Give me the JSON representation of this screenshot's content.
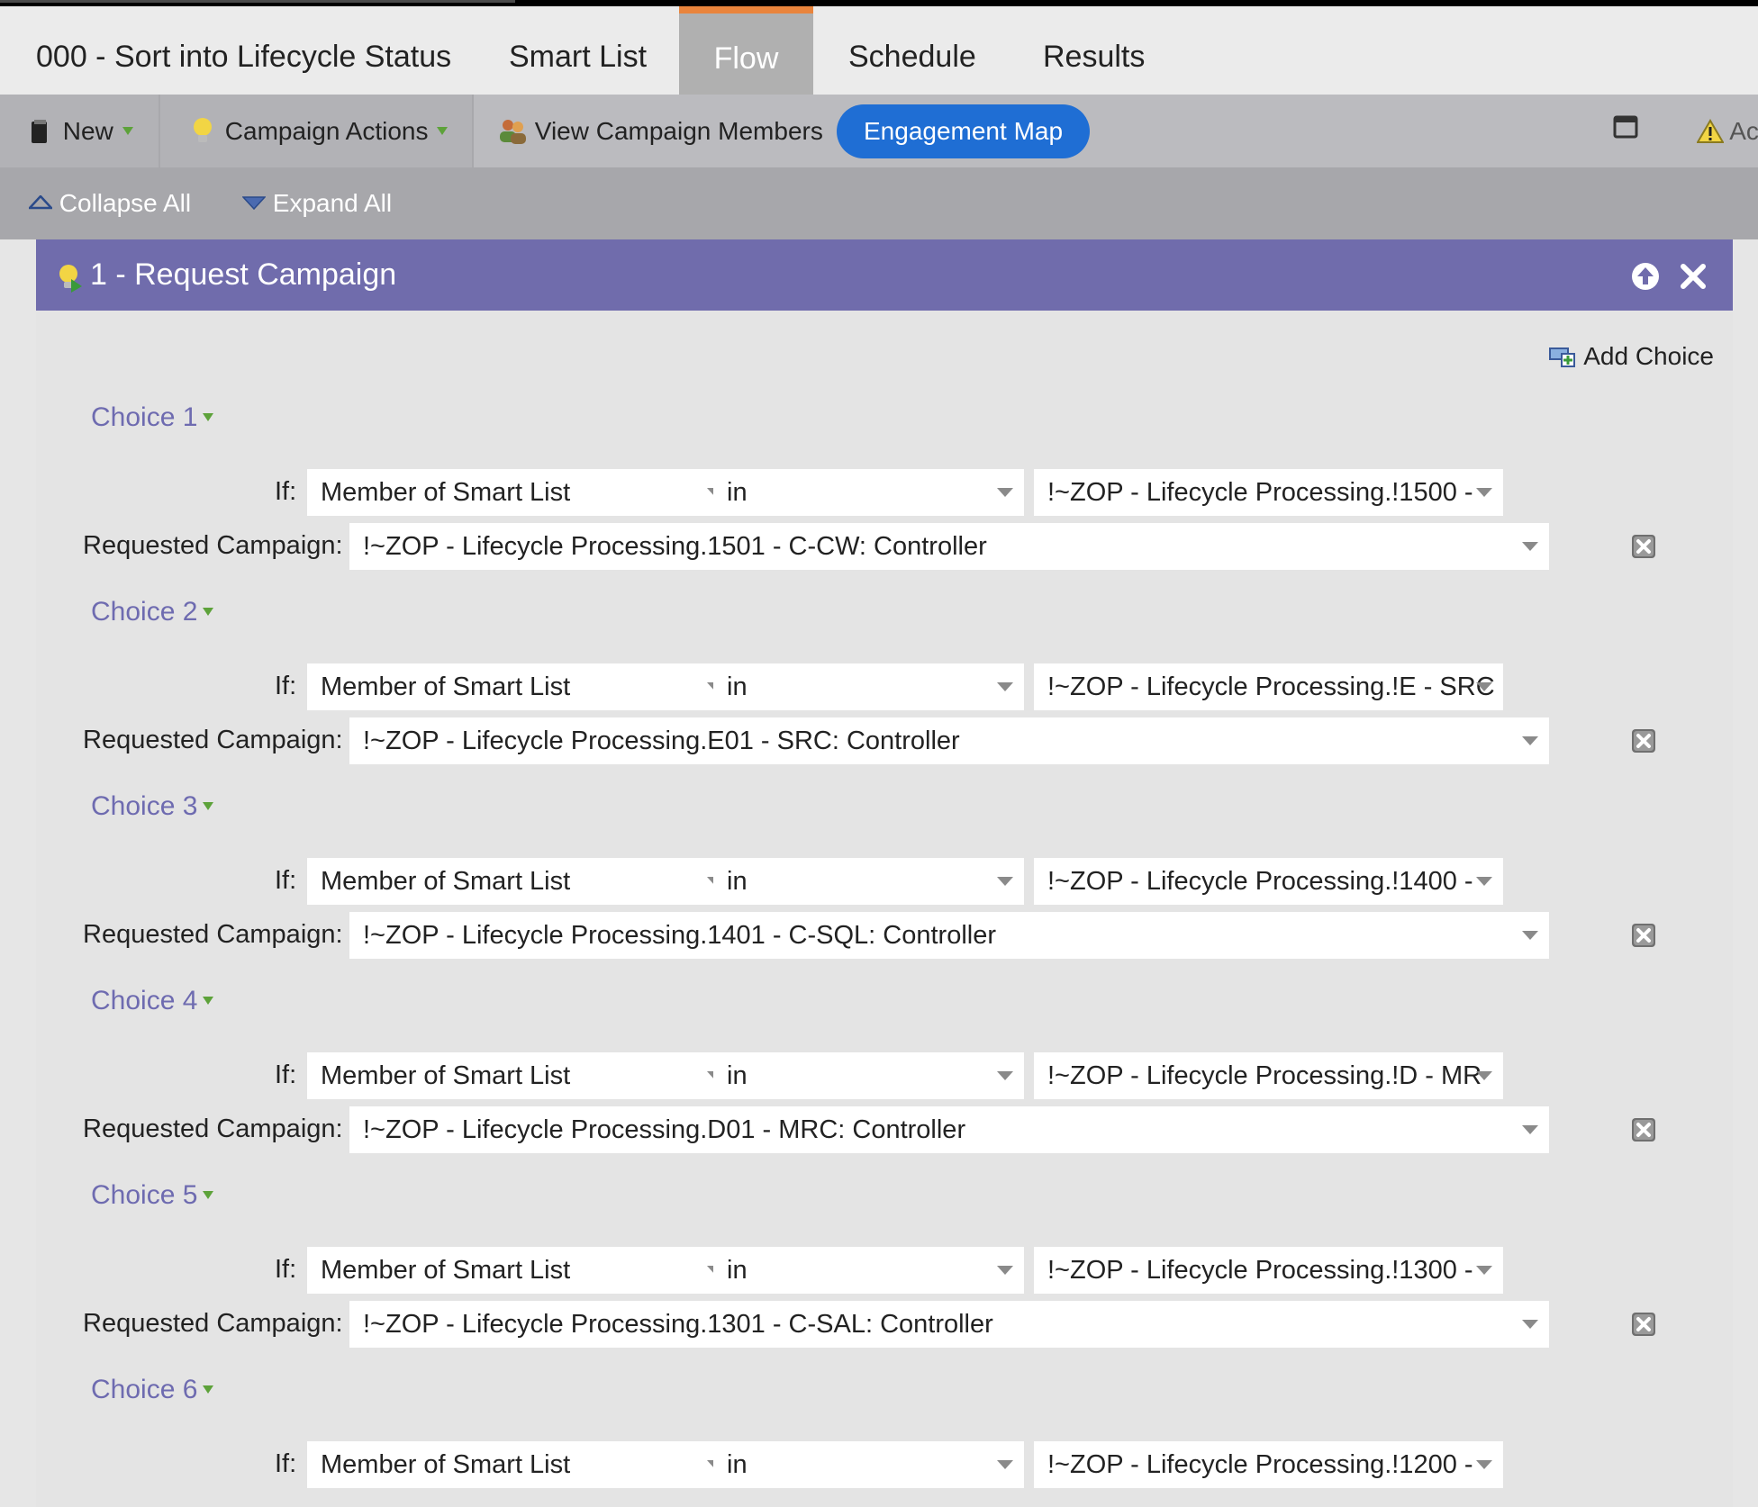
{
  "tabs": {
    "campaign_name": "000 - Sort into Lifecycle Status",
    "items": [
      {
        "label": "Smart List"
      },
      {
        "label": "Flow",
        "active": true
      },
      {
        "label": "Schedule"
      },
      {
        "label": "Results"
      }
    ],
    "accent_color": "#e9843c"
  },
  "toolbar": {
    "new_label": "New",
    "campaign_actions_label": "Campaign Actions",
    "view_members_label": "View Campaign Members",
    "engagement_map_label": "Engagement Map",
    "actions_partial_label": "Act",
    "pill_color": "#1f6ed4"
  },
  "collapse_bar": {
    "collapse_label": "Collapse All",
    "expand_label": "Expand All"
  },
  "flow_step": {
    "title": "1 - Request Campaign",
    "header_color": "#706cac",
    "add_choice_label": "Add Choice",
    "if_label": "If:",
    "requested_campaign_label": "Requested Campaign:",
    "choices": [
      {
        "label": "Choice 1",
        "condition": "Member of Smart List",
        "operator": "in",
        "smart_list": "!~ZOP - Lifecycle Processing.!1500 -",
        "requested_campaign": "!~ZOP - Lifecycle Processing.1501 - C-CW: Controller"
      },
      {
        "label": "Choice 2",
        "condition": "Member of Smart List",
        "operator": "in",
        "smart_list": "!~ZOP - Lifecycle Processing.!E - SRC",
        "requested_campaign": "!~ZOP - Lifecycle Processing.E01 - SRC: Controller"
      },
      {
        "label": "Choice 3",
        "condition": "Member of Smart List",
        "operator": "in",
        "smart_list": "!~ZOP - Lifecycle Processing.!1400 -",
        "requested_campaign": "!~ZOP - Lifecycle Processing.1401 - C-SQL: Controller"
      },
      {
        "label": "Choice 4",
        "condition": "Member of Smart List",
        "operator": "in",
        "smart_list": "!~ZOP - Lifecycle Processing.!D - MR",
        "requested_campaign": "!~ZOP - Lifecycle Processing.D01 - MRC: Controller"
      },
      {
        "label": "Choice 5",
        "condition": "Member of Smart List",
        "operator": "in",
        "smart_list": "!~ZOP - Lifecycle Processing.!1300 -",
        "requested_campaign": "!~ZOP - Lifecycle Processing.1301 - C-SAL: Controller"
      },
      {
        "label": "Choice 6",
        "condition": "Member of Smart List",
        "operator": "in",
        "smart_list": "!~ZOP - Lifecycle Processing.!1200 -"
      }
    ]
  }
}
